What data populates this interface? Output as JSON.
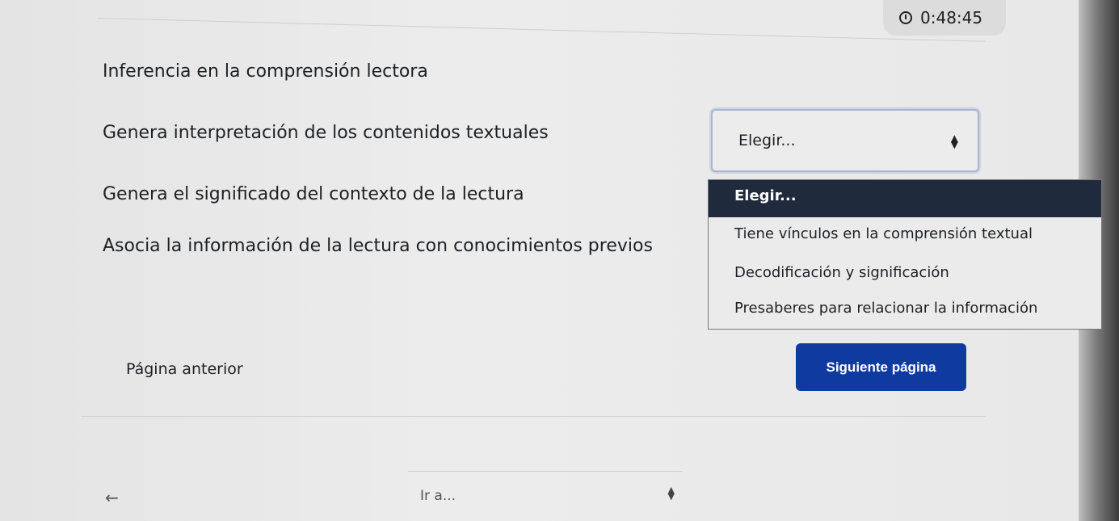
{
  "timer": {
    "icon": "clock-icon",
    "value": "0:48:45"
  },
  "question": {
    "title": "Inferencia en la comprensión lectora",
    "rows": [
      "Genera interpretación de los contenidos textuales",
      "Genera el significado del contexto de la lectura",
      "Asocia la información de la lectura con conocimientos previos"
    ],
    "select_value": "Elegir...",
    "dropdown_options": [
      "Elegir...",
      "Tiene vínculos en la comprensión textual",
      "Decodificación y significación",
      "Presaberes para relacionar la información"
    ]
  },
  "navigation": {
    "prev_label": "Página anterior",
    "next_label": "Siguiente página",
    "next_color": "#0f3a9f",
    "back_arrow": "←",
    "jump_placeholder": "Ir a..."
  }
}
